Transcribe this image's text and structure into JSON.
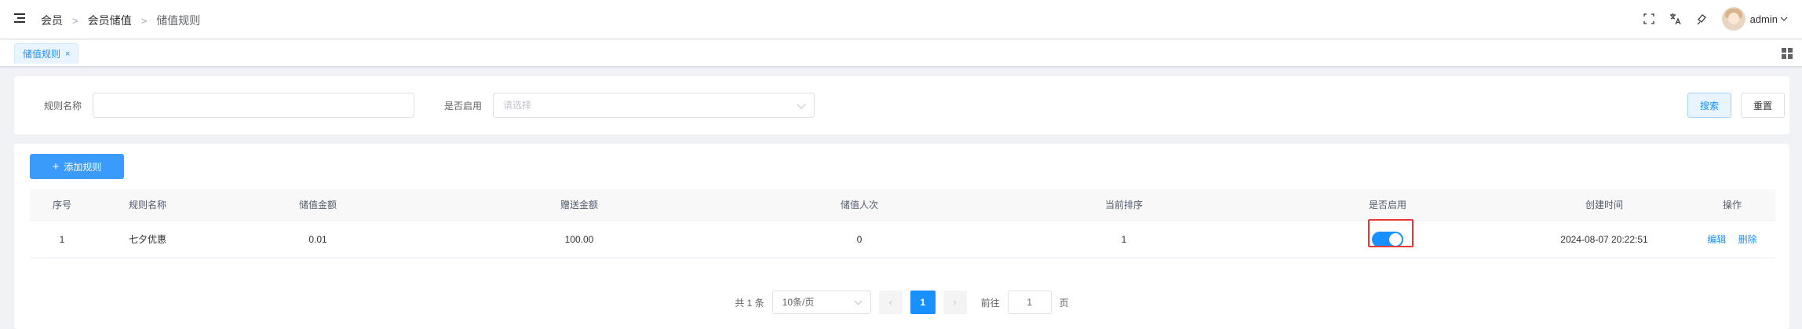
{
  "header": {
    "breadcrumb": [
      "会员",
      "会员储值",
      "储值规则"
    ],
    "separator": ">",
    "user_name": "admin",
    "icons": [
      "fullscreen-icon",
      "translate-icon",
      "theme-icon",
      "avatar"
    ]
  },
  "tags": {
    "active": "储值规则",
    "close": "×"
  },
  "search": {
    "rule_name_label": "规则名称",
    "rule_name_value": "",
    "enabled_label": "是否启用",
    "enabled_placeholder": "请选择",
    "search_button": "搜索",
    "reset_button": "重置"
  },
  "toolbar": {
    "add_button": "添加规则",
    "add_icon": "+"
  },
  "table": {
    "columns": [
      "序号",
      "规则名称",
      "储值金额",
      "赠送金额",
      "储值人次",
      "当前排序",
      "是否启用",
      "创建时间",
      "操作"
    ],
    "rows": [
      {
        "index": "1",
        "name": "七夕优惠",
        "amount": "0.01",
        "gift": "100.00",
        "count": "0",
        "sort": "1",
        "enabled": true,
        "created": "2024-08-07 20:22:51",
        "edit": "编辑",
        "delete": "删除"
      }
    ]
  },
  "pagination": {
    "total": "共 1 条",
    "page_size": "10条/页",
    "prev": "‹",
    "current": "1",
    "next": "›",
    "goto_label": "前往",
    "goto_value": "1",
    "page_unit": "页"
  },
  "colors": {
    "primary": "#1890ff",
    "highlight": "#e53935"
  }
}
